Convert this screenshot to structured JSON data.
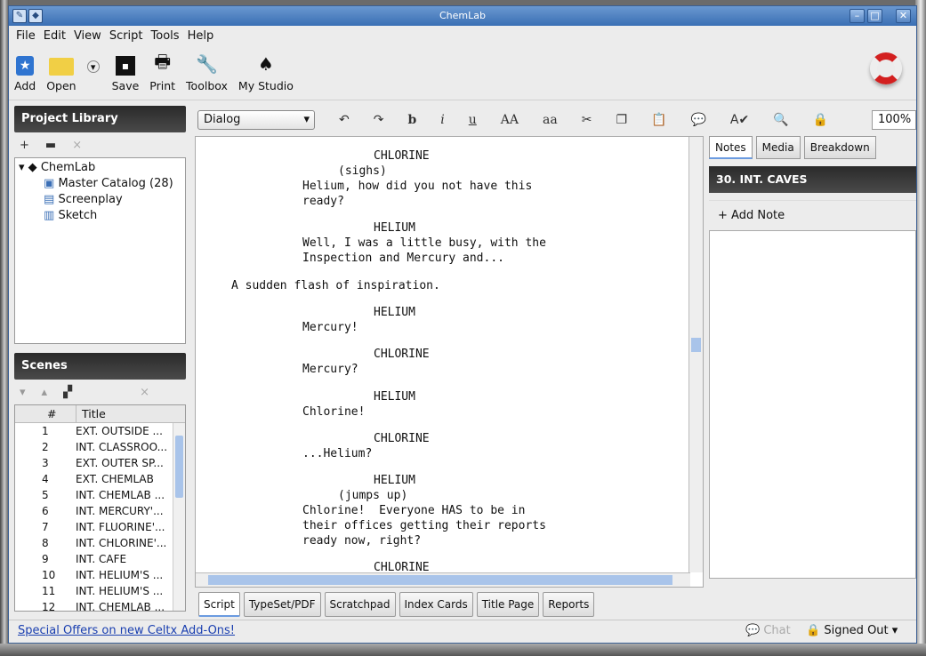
{
  "window": {
    "title": "ChemLab"
  },
  "menu": [
    "File",
    "Edit",
    "View",
    "Script",
    "Tools",
    "Help"
  ],
  "toolbar": {
    "add": "Add",
    "open": "Open",
    "save": "Save",
    "print": "Print",
    "toolbox": "Toolbox",
    "studio": "My Studio"
  },
  "library": {
    "title": "Project Library",
    "items": [
      "ChemLab",
      "Master Catalog (28)",
      "Screenplay",
      "Sketch"
    ]
  },
  "scenes": {
    "title": "Scenes",
    "col_num": "#",
    "col_title": "Title",
    "rows": [
      {
        "n": "1",
        "t": "EXT. OUTSIDE ..."
      },
      {
        "n": "2",
        "t": "INT. CLASSROO..."
      },
      {
        "n": "3",
        "t": "EXT. OUTER SP..."
      },
      {
        "n": "4",
        "t": "EXT. CHEMLAB"
      },
      {
        "n": "5",
        "t": "INT. CHEMLAB ..."
      },
      {
        "n": "6",
        "t": "INT. MERCURY'..."
      },
      {
        "n": "7",
        "t": "INT. FLUORINE'..."
      },
      {
        "n": "8",
        "t": "INT. CHLORINE'..."
      },
      {
        "n": "9",
        "t": "INT. CAFE"
      },
      {
        "n": "10",
        "t": "INT. HELIUM'S ..."
      },
      {
        "n": "11",
        "t": "INT. HELIUM'S ..."
      },
      {
        "n": "12",
        "t": "INT. CHEMLAB ..."
      }
    ]
  },
  "editor": {
    "element_type": "Dialog",
    "zoom": "100%",
    "format": {
      "bold": "b",
      "italic": "i",
      "underline": "u",
      "upper": "AA",
      "lower": "aa"
    }
  },
  "script_lines": [
    "CHLORINE",
    "(sighs)",
    "Helium, how did you not have this",
    "ready?",
    "HELIUM",
    "Well, I was a little busy, with the",
    "Inspection and Mercury and...",
    "A sudden flash of inspiration.",
    "HELIUM",
    "Mercury!",
    "CHLORINE",
    "Mercury?",
    "HELIUM",
    "Chlorine!",
    "CHLORINE",
    "...Helium?",
    "HELIUM",
    "(jumps up)",
    "Chlorine!  Everyone HAS to be in",
    "their offices getting their reports",
    "ready now, right?",
    "CHLORINE"
  ],
  "bottom_tabs": [
    "Script",
    "TypeSet/PDF",
    "Scratchpad",
    "Index Cards",
    "Title Page",
    "Reports"
  ],
  "right_panel": {
    "tabs": [
      "Notes",
      "Media",
      "Breakdown"
    ],
    "scene": "30. INT. CAVES",
    "add_note": "Add Note"
  },
  "status": {
    "offer_link": "Special Offers on new Celtx Add-Ons!",
    "chat": "Chat",
    "signed": "Signed Out"
  }
}
